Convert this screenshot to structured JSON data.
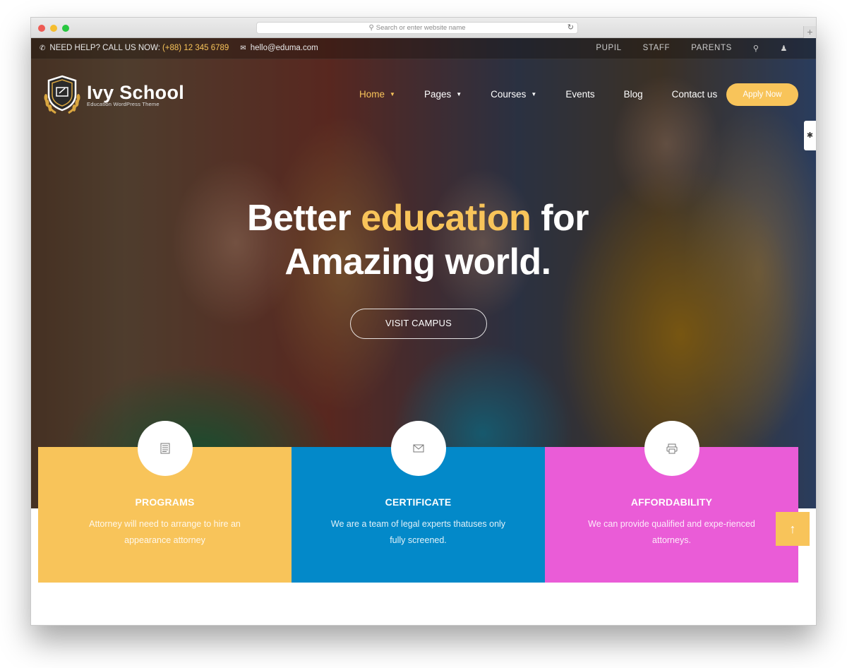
{
  "browser": {
    "url_placeholder": "Search or enter website name",
    "search_icon": "search-icon",
    "reload_icon": "reload-icon",
    "new_tab_label": "+"
  },
  "topbar": {
    "help_text": "NEED HELP? CALL US NOW:",
    "phone": "(+88) 12 345 6789",
    "email": "hello@eduma.com",
    "links": [
      "PUPIL",
      "STAFF",
      "PARENTS"
    ],
    "icons": [
      "phone-icon",
      "mail-icon",
      "search-icon",
      "user-icon"
    ]
  },
  "logo": {
    "title": "Ivy School",
    "subtitle": "Education WordPress Theme"
  },
  "nav": {
    "items": [
      {
        "label": "Home",
        "dropdown": true,
        "active": true
      },
      {
        "label": "Pages",
        "dropdown": true,
        "active": false
      },
      {
        "label": "Courses",
        "dropdown": true,
        "active": false
      },
      {
        "label": "Events",
        "dropdown": false,
        "active": false
      },
      {
        "label": "Blog",
        "dropdown": false,
        "active": false
      },
      {
        "label": "Contact us",
        "dropdown": false,
        "active": false
      }
    ],
    "cta_label": "Apply Now"
  },
  "hero": {
    "headline_part1": "Better ",
    "headline_accent": "education",
    "headline_part2": " for",
    "headline_line2": "Amazing world.",
    "button_label": "VISIT CAMPUS"
  },
  "features": [
    {
      "title": "PROGRAMS",
      "description": "Attorney will need to arrange to hire an appearance attorney",
      "icon": "document-icon",
      "color": "#f8c45a"
    },
    {
      "title": "CERTIFICATE",
      "description": "We are a team of legal experts thatuses only fully screened.",
      "icon": "envelope-icon",
      "color": "#0389c9"
    },
    {
      "title": "AFFORDABILITY",
      "description": "We can provide qualified and expe-rienced attorneys.",
      "icon": "printer-icon",
      "color": "#ea5cd7"
    }
  ],
  "colors": {
    "accent": "#f8c45a",
    "blue": "#0389c9",
    "pink": "#ea5cd7"
  },
  "scroll_top_label": "↑"
}
